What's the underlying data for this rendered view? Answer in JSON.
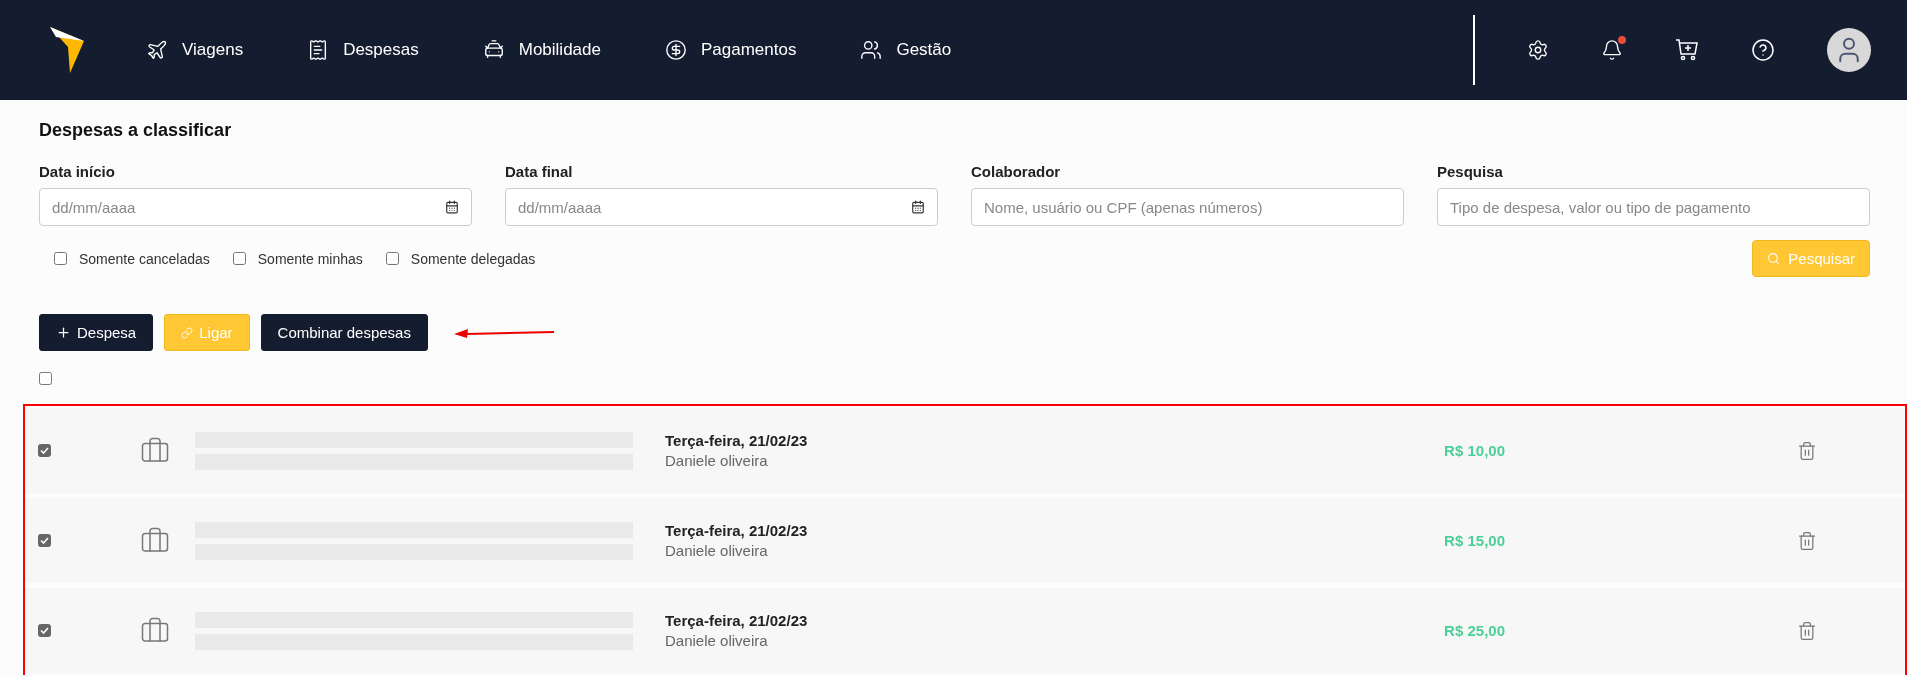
{
  "nav": [
    {
      "kind": "travel",
      "label": "Viagens"
    },
    {
      "kind": "expenses",
      "label": "Despesas"
    },
    {
      "kind": "mobility",
      "label": "Mobilidade"
    },
    {
      "kind": "payments",
      "label": "Pagamentos"
    },
    {
      "kind": "management",
      "label": "Gestão"
    }
  ],
  "notifications": {
    "unread": true
  },
  "page_title": "Despesas a classificar",
  "filters": [
    {
      "label": "Data início",
      "placeholder": "dd/mm/aaaa",
      "kind": "date"
    },
    {
      "label": "Data final",
      "placeholder": "dd/mm/aaaa",
      "kind": "date"
    },
    {
      "label": "Colaborador",
      "placeholder": "Nome, usuário ou CPF (apenas números)",
      "kind": "text"
    },
    {
      "label": "Pesquisa",
      "placeholder": "Tipo de despesa, valor ou tipo de pagamento",
      "kind": "text"
    }
  ],
  "options": [
    {
      "label": "Somente canceladas",
      "checked": false
    },
    {
      "label": "Somente minhas",
      "checked": false
    },
    {
      "label": "Somente delegadas",
      "checked": false
    }
  ],
  "search_button": "Pesquisar",
  "actions": [
    {
      "kind": "add",
      "label": "Despesa"
    },
    {
      "kind": "link",
      "label": "Ligar"
    },
    {
      "kind": "combine",
      "label": "Combinar despesas"
    }
  ],
  "select_all": {
    "checked": false
  },
  "expenses": [
    {
      "checked": true,
      "date": "Terça-feira, 21/02/23",
      "person": "Daniele oliveira",
      "amount": "R$ 10,00"
    },
    {
      "checked": true,
      "date": "Terça-feira, 21/02/23",
      "person": "Daniele oliveira",
      "amount": "R$ 15,00"
    },
    {
      "checked": true,
      "date": "Terça-feira, 21/02/23",
      "person": "Daniele oliveira",
      "amount": "R$ 25,00"
    }
  ]
}
